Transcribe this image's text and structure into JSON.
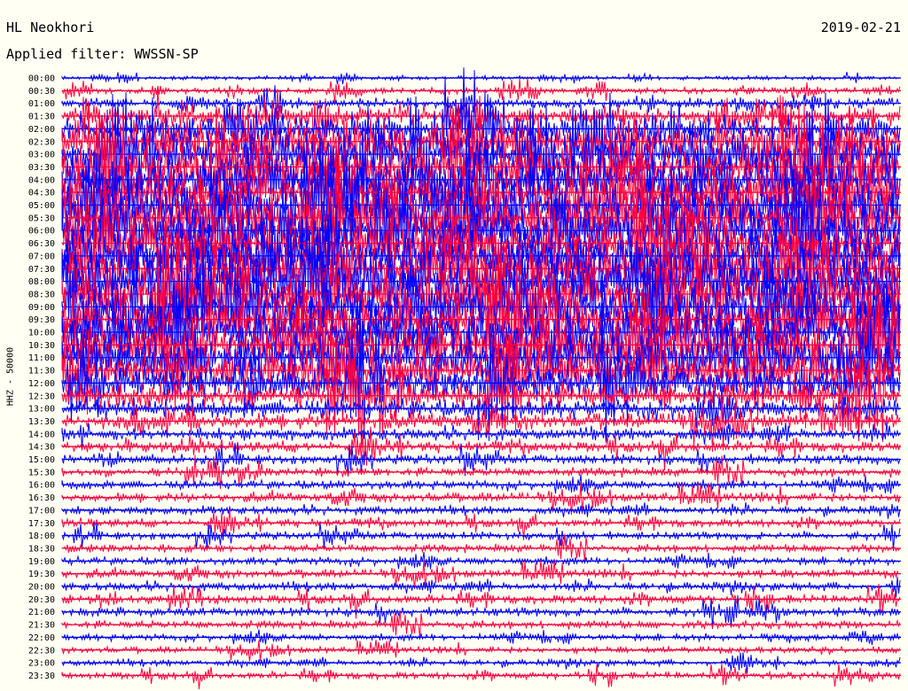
{
  "header": {
    "station": "HL Neokhori",
    "filter": "Applied filter: WWSSN-SP",
    "date": "2019-02-21"
  },
  "chart_data": {
    "type": "line",
    "ylabel": "HHZ - 50000",
    "time_labels": [
      "00:00",
      "00:30",
      "01:00",
      "01:30",
      "02:00",
      "02:30",
      "03:00",
      "03:30",
      "04:00",
      "04:30",
      "05:00",
      "05:30",
      "06:00",
      "06:30",
      "07:00",
      "07:30",
      "08:00",
      "08:30",
      "09:00",
      "09:30",
      "10:00",
      "10:30",
      "11:00",
      "11:30",
      "12:00",
      "12:30",
      "13:00",
      "13:30",
      "14:00",
      "14:30",
      "15:00",
      "15:30",
      "16:00",
      "16:30",
      "17:00",
      "17:30",
      "18:00",
      "18:30",
      "19:00",
      "19:30",
      "20:00",
      "20:30",
      "21:00",
      "21:30",
      "22:00",
      "22:30",
      "23:00",
      "23:30"
    ],
    "trace_colors": [
      "#0000ff",
      "#ff0040"
    ],
    "amplitude_profile": [
      0.2,
      0.3,
      0.5,
      1.0,
      1.6,
      2.2,
      2.6,
      2.8,
      3.0,
      3.0,
      3.0,
      3.0,
      3.0,
      3.0,
      3.0,
      3.0,
      3.0,
      3.0,
      3.0,
      3.0,
      3.0,
      2.9,
      2.7,
      2.3,
      1.8,
      1.4,
      1.0,
      0.8,
      0.6,
      0.55,
      0.5,
      0.45,
      0.45,
      0.45,
      0.4,
      0.4,
      0.4,
      0.4,
      0.4,
      0.4,
      0.4,
      0.45,
      0.45,
      0.4,
      0.35,
      0.3,
      0.3,
      0.35
    ]
  }
}
